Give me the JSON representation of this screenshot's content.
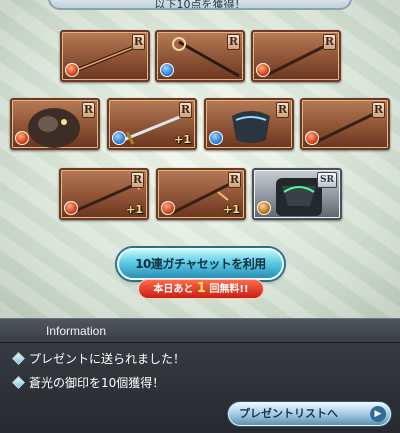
{
  "banner": {
    "text": "以下10点を獲得！"
  },
  "cards": [
    {
      "rarity": "R",
      "element": "fire",
      "plus": ""
    },
    {
      "rarity": "R",
      "element": "water",
      "plus": ""
    },
    {
      "rarity": "R",
      "element": "fire",
      "plus": ""
    },
    {
      "rarity": "R",
      "element": "fire",
      "plus": ""
    },
    {
      "rarity": "R",
      "element": "water",
      "plus": "+1"
    },
    {
      "rarity": "R",
      "element": "water",
      "plus": ""
    },
    {
      "rarity": "R",
      "element": "fire",
      "plus": ""
    },
    {
      "rarity": "R",
      "element": "fire",
      "plus": "+1"
    },
    {
      "rarity": "R",
      "element": "fire",
      "plus": "+1"
    },
    {
      "rarity": "SR",
      "element": "earth",
      "plus": ""
    }
  ],
  "gacha_button": {
    "label": "10連ガチャセットを利用"
  },
  "free_badge": {
    "prefix": "本日あと",
    "count": "1",
    "suffix": "回無料!!"
  },
  "info": {
    "title": "Information",
    "messages": [
      "プレゼントに送られました！",
      "蒼光の御印を10個獲得！"
    ]
  },
  "present_button": {
    "label": "プレゼントリストへ"
  },
  "colors": {
    "fire": "#d8401a",
    "water": "#2f7fe0",
    "earth": "#c2741d"
  }
}
